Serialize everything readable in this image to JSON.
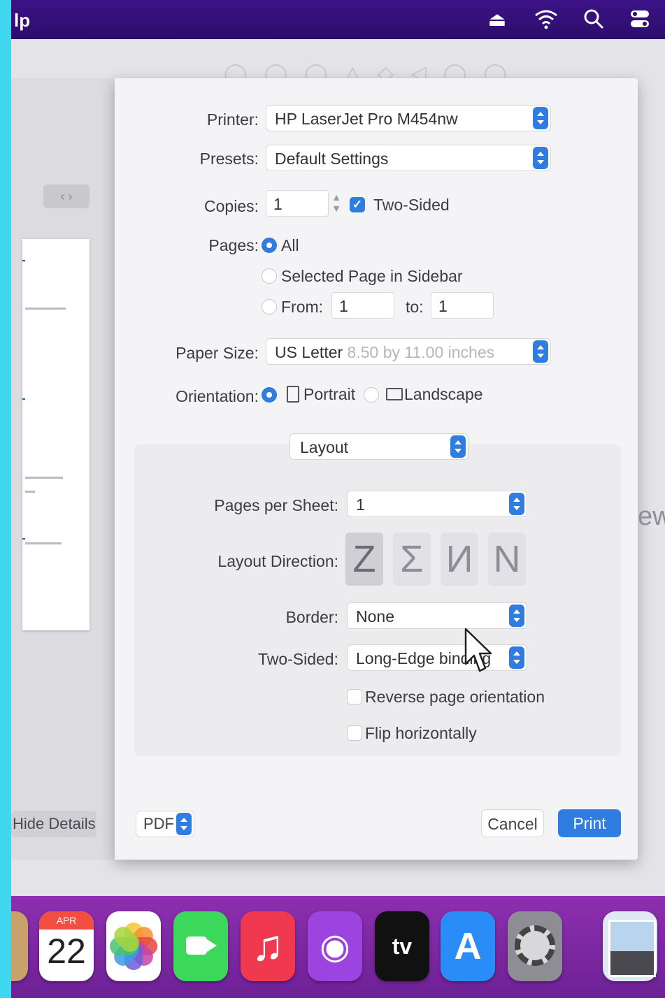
{
  "menubar": {
    "app_name": "lp",
    "icons": [
      "eject-icon",
      "wifi-icon",
      "spotlight-search-icon",
      "control-center-icon"
    ]
  },
  "sidebar": {
    "hide_details_label": "Hide Details"
  },
  "print_dialog": {
    "printer_label": "Printer:",
    "printer_value": "HP LaserJet Pro M454nw",
    "presets_label": "Presets:",
    "presets_value": "Default Settings",
    "copies_label": "Copies:",
    "copies_value": "1",
    "two_sided_check_label": "Two-Sided",
    "two_sided_checked": true,
    "pages_label": "Pages:",
    "pages_all_label": "All",
    "pages_selected_label": "Selected Page in Sidebar",
    "pages_from_label": "From:",
    "pages_from_value": "1",
    "pages_to_label": "to:",
    "pages_to_value": "1",
    "paper_size_label": "Paper Size:",
    "paper_size_value": "US Letter",
    "paper_size_detail": "8.50 by 11.00 inches",
    "orientation_label": "Orientation:",
    "orientation_portrait": "Portrait",
    "orientation_landscape": "Landscape",
    "section_value": "Layout",
    "pages_per_sheet_label": "Pages per Sheet:",
    "pages_per_sheet_value": "1",
    "layout_direction_label": "Layout Direction:",
    "layout_directions": [
      "Z",
      "Σ",
      "И",
      "N"
    ],
    "border_label": "Border:",
    "border_value": "None",
    "two_sided_label": "Two-Sided:",
    "two_sided_value": "Long-Edge binding",
    "reverse_label": "Reverse page orientation",
    "flip_label": "Flip horizontally",
    "pdf_label": "PDF",
    "cancel_label": "Cancel",
    "print_label": "Print"
  },
  "right_fragment": "ew",
  "dock": {
    "calendar_month": "APR",
    "calendar_day": "22",
    "tv_label": "tv",
    "accent": "#2f7de1"
  }
}
